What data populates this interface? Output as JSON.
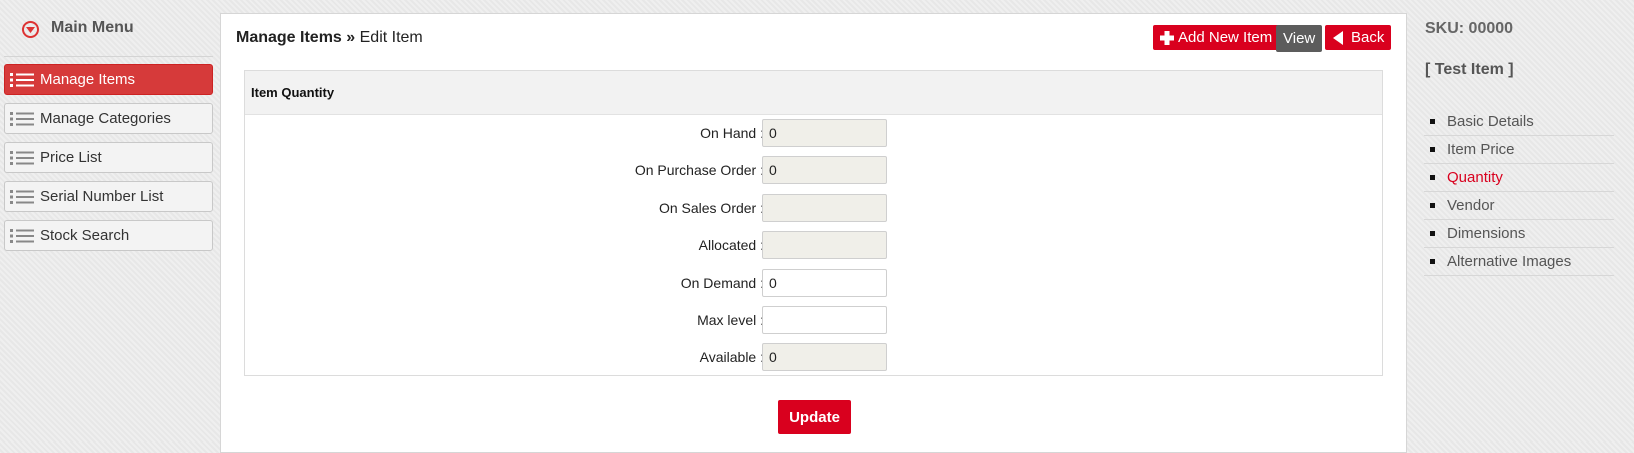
{
  "main_menu": {
    "title": "Main Menu",
    "items": [
      {
        "label": "Manage Items",
        "active": true
      },
      {
        "label": "Manage Categories",
        "active": false
      },
      {
        "label": "Price List",
        "active": false
      },
      {
        "label": "Serial Number List",
        "active": false
      },
      {
        "label": "Stock Search",
        "active": false
      }
    ]
  },
  "header": {
    "breadcrumb_section": "Manage Items",
    "breadcrumb_sep": "»",
    "breadcrumb_page": "Edit Item",
    "add_new_label": "Add New Item",
    "view_label": "View",
    "back_label": "Back"
  },
  "quantity_panel": {
    "title": "Item Quantity",
    "fields": [
      {
        "label": "On Hand :",
        "value": "0",
        "readonly": true
      },
      {
        "label": "On Purchase Order :",
        "value": "0",
        "readonly": true
      },
      {
        "label": "On Sales Order :",
        "value": "",
        "readonly": true
      },
      {
        "label": "Allocated :",
        "value": "",
        "readonly": true
      },
      {
        "label": "On Demand :",
        "value": "0",
        "readonly": false
      },
      {
        "label": "Max level :",
        "value": "",
        "readonly": false
      },
      {
        "label": "Available :",
        "value": "0",
        "readonly": true
      }
    ],
    "update_label": "Update"
  },
  "item_info": {
    "sku": "SKU: 00000",
    "name": "[ Test Item ]",
    "sections": [
      {
        "label": "Basic Details",
        "active": false
      },
      {
        "label": "Item Price",
        "active": false
      },
      {
        "label": "Quantity",
        "active": true
      },
      {
        "label": "Vendor",
        "active": false
      },
      {
        "label": "Dimensions",
        "active": false
      },
      {
        "label": "Alternative Images",
        "active": false
      }
    ]
  },
  "colors": {
    "accent": "#d9001e",
    "active_nav": "#d63a3a",
    "view_button": "#5c5c5c"
  },
  "icons": {
    "menu_toggle": "chevron-down-circle-icon",
    "nav_item": "list-icon",
    "add": "plus-icon",
    "back": "triangle-left-icon",
    "section_bullet": "square-bullet-icon"
  }
}
